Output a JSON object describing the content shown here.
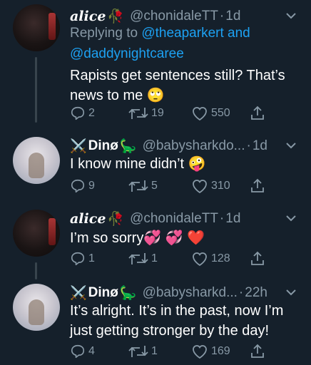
{
  "tweets": [
    {
      "name": "alice",
      "name_emoji": "🥀",
      "handle": "@chonidaleTT",
      "time": "1d",
      "replying_prefix": "Replying to",
      "replying_user1": "@theaparkert",
      "replying_and": "and",
      "replying_user2": "@daddynightcaree",
      "text": "Rapists get sentences still? That’s news to me 🙄",
      "replies": "2",
      "retweets": "19",
      "likes": "550"
    },
    {
      "name": "Dinø",
      "name_prefix_emoji": "⚔️",
      "name_emoji": "🦕",
      "handle": "@babysharkdo...",
      "time": "1d",
      "text": "I know mine didn’t 🤪",
      "replies": "9",
      "retweets": "5",
      "likes": "310"
    },
    {
      "name": "alice",
      "name_emoji": "🥀",
      "handle": "@chonidaleTT",
      "time": "1d",
      "text": "I’m so sorry💞 💞 ❤️",
      "replies": "1",
      "retweets": "1",
      "likes": "128"
    },
    {
      "name": "Dinø",
      "name_prefix_emoji": "⚔️",
      "name_emoji": "🦕",
      "handle": "@babysharkd...",
      "time": "22h",
      "text": "It’s alright. It’s in the past, now I’m just getting stronger by the day!",
      "replies": "4",
      "retweets": "1",
      "likes": "169"
    }
  ],
  "colors": {
    "background": "#15202b",
    "secondary_text": "#8899a6",
    "link": "#1da1f2",
    "thread_line": "#38444d"
  },
  "icons": [
    "reply-icon",
    "retweet-icon",
    "like-icon",
    "share-icon",
    "chevron-down-icon"
  ]
}
